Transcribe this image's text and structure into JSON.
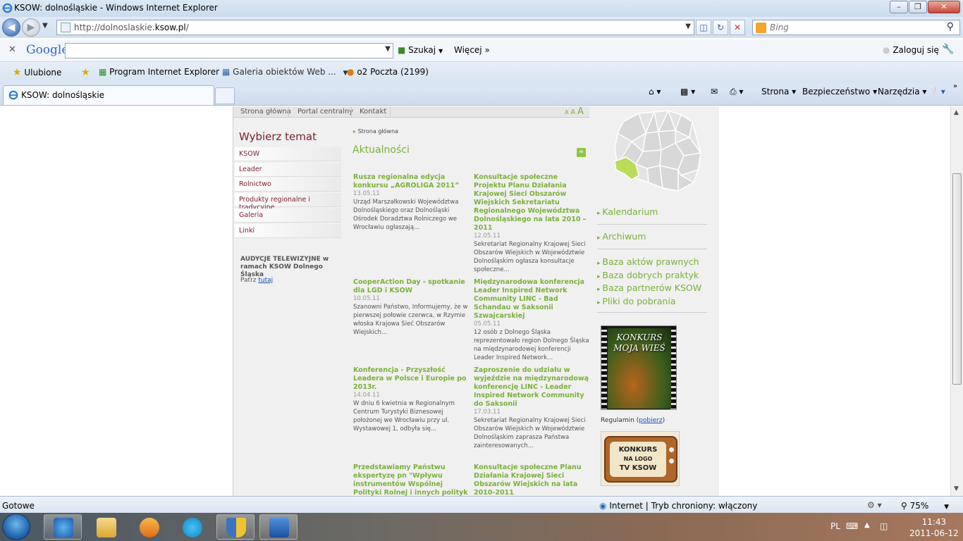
{
  "window": {
    "title": "KSOW: dolnośląskie - Windows Internet Explorer"
  },
  "address": {
    "url_prefix": "http://dolnoslaskie.",
    "url_domain": "ksow.pl",
    "url_suffix": "/"
  },
  "search": {
    "placeholder": "Bing"
  },
  "googlebar": {
    "logo": "Google",
    "search_label": "Szukaj",
    "more_label": "Więcej",
    "login_label": "Zaloguj się"
  },
  "favorites": {
    "ulubione": "Ulubione",
    "items": [
      "Program Internet Explorer ...",
      "Galeria obiektów Web ...",
      "o2 Poczta (2199)"
    ]
  },
  "tabs": {
    "active": "KSOW: dolnośląskie"
  },
  "commandbar": {
    "strona": "Strona",
    "bezpieczenstwo": "Bezpieczeństwo",
    "narzedzia": "Narzędzia"
  },
  "site": {
    "topnav": [
      "Strona główna",
      "Portal centralny",
      "Kontakt"
    ],
    "fontsize": "A A A",
    "choose_topic": "Wybierz temat",
    "menu": [
      "KSOW",
      "Leader",
      "Rolnictwo",
      "Produkty regionalne i tradycyjne",
      "Galeria",
      "Linki"
    ],
    "audycje": "AUDYCJE TELEWIZYJNE w ramach KSOW Dolnego Śląska",
    "patrz": "Patrz",
    "patrz_link": "tutaj",
    "breadcrumb": "Strona główna",
    "news_title": "Aktualności",
    "news": [
      {
        "title": "Rusza regionalna edycja konkursu „AGROLIGA 2011”",
        "date": "13.05.11",
        "text": "Urząd Marszałkowski Województwa Dolnośląskiego oraz Dolnośląski Ośrodek Doradztwa Rolniczego we Wrocławiu ogłaszają..."
      },
      {
        "title": "Konsultacje społeczne Projektu Planu Działania Krajowej Sieci Obszarów Wiejskich Sekretariatu Regionalnego Województwa Dolnośląskiego na lata 2010 – 2011",
        "date": "12.05.11",
        "text": "Sekretariat Regionalny Krajowej Sieci Obszarów Wiejskich w Województwie Dolnośląskim ogłasza konsultacje społeczne..."
      },
      {
        "title": "CooperAction Day - spotkanie dla LGD i KSOW",
        "date": "10.05.11",
        "text": "Szanowni Państwo, Informujemy, że w pierwszej połowie czerwca, w Rzymie włoska Krajowa Sieć Obszarów Wiejskich..."
      },
      {
        "title": "Międzynarodowa konferencja Leader Inspired Network Community LINC - Bad Schandau w Saksonii Szwajcarskiej",
        "date": "05.05.11",
        "text": "12 osób z Dolnego Śląska reprezentowało region Dolnego Śląska na międzynarodowej konferencji Leader Inspired Network..."
      },
      {
        "title": "Konferencja - Przyszłość Leadera w Polsce i Europie po 2013r.",
        "date": "14.04.11",
        "text": "W dniu 6 kwietnia w Regionalnym Centrum Turystyki Biznesowej położonej we Wrocławiu przy ul. Wystawowej 1, odbyła się..."
      },
      {
        "title": "Zaproszenie do udziału w wyjeździe na międzynarodową konferencję LINC - Leader Inspired Network Community do Saksonii",
        "date": "17.03.11",
        "text": "Sekretariat Regionalny Krajowej Sieci Obszarów Wiejskich w Województwie Dolnośląskim zaprasza Państwa zainteresowanych..."
      },
      {
        "title": "Przedstawiamy Państwu ekspertyzę pn \"Wpływu instrumentów Wspólnej Polityki Rolnej i innych polityk",
        "date": "",
        "text": ""
      },
      {
        "title": "Konsultacje społeczne Planu Działania Krajowej Sieci Obszarów Wiejskich na lata 2010-2011",
        "date": "",
        "text": ""
      }
    ],
    "right_links": [
      "Kalendarium",
      "Archiwum",
      "Baza aktów prawnych",
      "Baza dobrych praktyk",
      "Baza partnerów KSOW",
      "Pliki do pobrania"
    ],
    "poster1_text": "KONKURS MOJA WIEŚ",
    "regulamin": "Regulamin",
    "regulamin_link": "pobierz",
    "poster2_line1": "KONKURS",
    "poster2_line2": "NA LOGO",
    "poster2_line3": "TV KSOW"
  },
  "status": {
    "text": "Gotowe",
    "zone": "Internet | Tryb chroniony: włączony",
    "zoom": "75%"
  },
  "taskbar": {
    "lang": "PL",
    "time": "11:43",
    "date": "2011-06-12"
  },
  "colors": {
    "accent_green": "#7ab13a",
    "menu_red": "#7a1e2e",
    "link_blue": "#1a4fb8"
  }
}
